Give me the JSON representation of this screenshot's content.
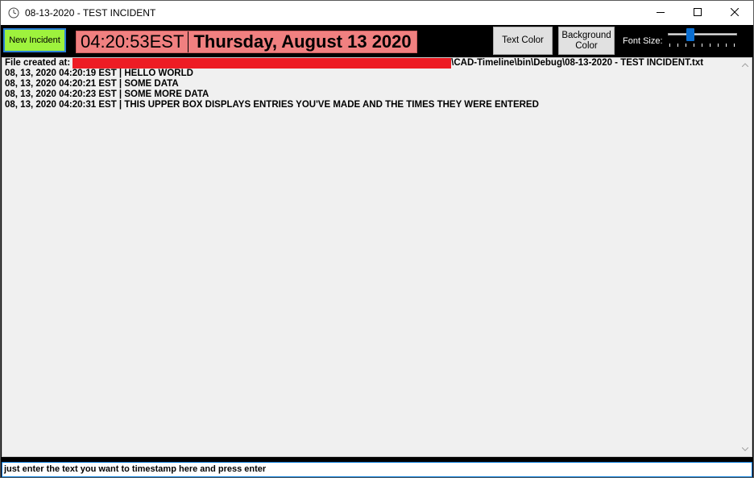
{
  "window": {
    "title": "08-13-2020 - TEST INCIDENT",
    "icons": {
      "app": "clock-icon",
      "minimize": "minimize-icon",
      "maximize": "maximize-icon",
      "close": "close-icon"
    }
  },
  "toolbar": {
    "new_incident_label": "New Incident",
    "clock_time": "04:20:53EST",
    "clock_date": "Thursday, August 13 2020",
    "text_color_label": "Text Color",
    "background_color_label": "Background Color",
    "font_size_label": "Font Size:",
    "font_size_slider": {
      "value": 3,
      "min": 0,
      "max": 10
    }
  },
  "log": {
    "file_prefix": "File created at:",
    "file_path_suffix": "\\CAD-Timeline\\bin\\Debug\\08-13-2020 - TEST INCIDENT.txt",
    "entries": [
      "08, 13, 2020 04:20:19 EST  |  HELLO WORLD",
      "08, 13, 2020 04:20:21 EST  |  SOME DATA",
      "08, 13, 2020 04:20:23 EST  |  SOME MORE DATA",
      "08, 13, 2020 04:20:31 EST  |  THIS UPPER BOX DISPLAYS ENTRIES YOU'VE MADE AND THE TIMES THEY WERE ENTERED"
    ]
  },
  "input": {
    "value": "just enter the text you want to timestamp here and press enter"
  },
  "colors": {
    "new_incident_bg": "#9ef23d",
    "clock_bg": "#f08080",
    "redaction": "#ed1c24",
    "slider_thumb": "#0a6ed1",
    "toolbar_bg": "#000000"
  }
}
